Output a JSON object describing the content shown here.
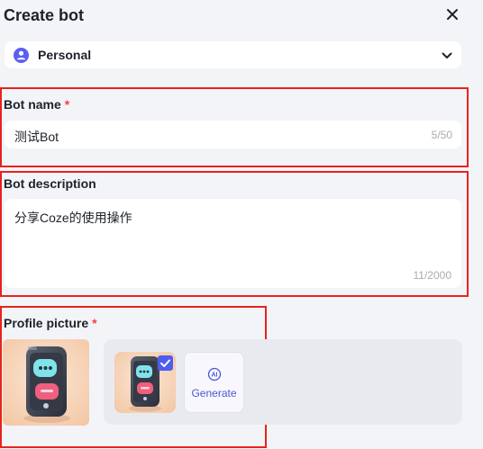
{
  "header": {
    "title": "Create bot"
  },
  "workspace": {
    "selected": "Personal"
  },
  "bot_name": {
    "label": "Bot name",
    "required_mark": "*",
    "value": "测试Bot",
    "counter": "5/50"
  },
  "bot_description": {
    "label": "Bot description",
    "value": "分享Coze的使用操作",
    "counter": "11/2000"
  },
  "profile_picture": {
    "label": "Profile picture",
    "required_mark": "*",
    "generate_label": "Generate",
    "ai_badge": "AI"
  },
  "colors": {
    "accent": "#4f5cf0",
    "highlight_border": "#e8221e",
    "required": "#f53f3f"
  }
}
